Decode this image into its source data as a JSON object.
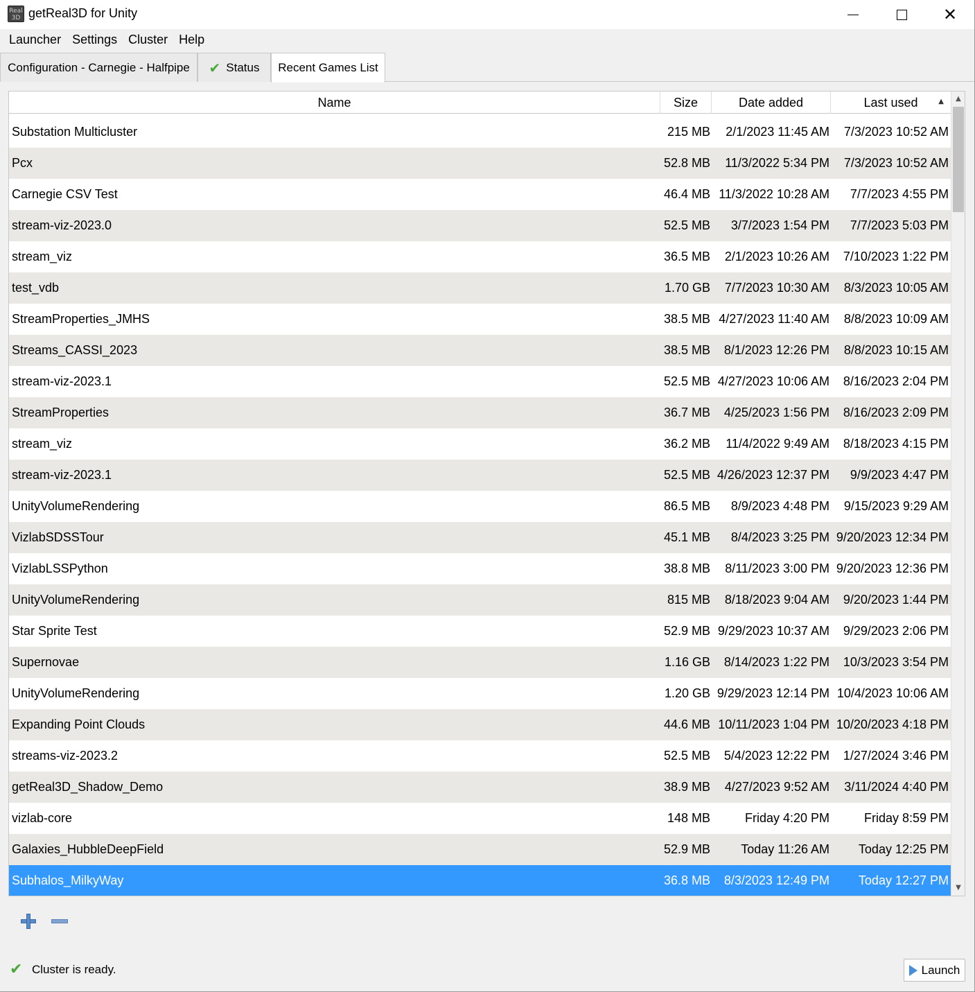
{
  "window": {
    "title": "getReal3D for Unity",
    "icon_label": "Real 3D"
  },
  "menu": [
    "Launcher",
    "Settings",
    "Cluster",
    "Help"
  ],
  "tabs": [
    {
      "label": "Configuration - Carnegie - Halfpipe",
      "active": false
    },
    {
      "label": "Status",
      "icon": "check-icon",
      "active": false
    },
    {
      "label": "Recent Games List",
      "active": true
    }
  ],
  "table": {
    "columns": {
      "name": "Name",
      "size": "Size",
      "date_added": "Date added",
      "last_used": "Last used"
    },
    "sort_column": "last_used",
    "sort_direction": "ascending",
    "rows": [
      {
        "name": "Substation Multicluster",
        "size": "215 MB",
        "date_added": "2/1/2023 11:45 AM",
        "last_used": "7/3/2023 10:52 AM"
      },
      {
        "name": "Pcx",
        "size": "52.8 MB",
        "date_added": "11/3/2022 5:34 PM",
        "last_used": "7/3/2023 10:52 AM"
      },
      {
        "name": "Carnegie CSV Test",
        "size": "46.4 MB",
        "date_added": "11/3/2022 10:28 AM",
        "last_used": "7/7/2023 4:55 PM"
      },
      {
        "name": "stream-viz-2023.0",
        "size": "52.5 MB",
        "date_added": "3/7/2023 1:54 PM",
        "last_used": "7/7/2023 5:03 PM"
      },
      {
        "name": "stream_viz",
        "size": "36.5 MB",
        "date_added": "2/1/2023 10:26 AM",
        "last_used": "7/10/2023 1:22 PM"
      },
      {
        "name": "test_vdb",
        "size": "1.70 GB",
        "date_added": "7/7/2023 10:30 AM",
        "last_used": "8/3/2023 10:05 AM"
      },
      {
        "name": "StreamProperties_JMHS",
        "size": "38.5 MB",
        "date_added": "4/27/2023 11:40 AM",
        "last_used": "8/8/2023 10:09 AM"
      },
      {
        "name": "Streams_CASSI_2023",
        "size": "38.5 MB",
        "date_added": "8/1/2023 12:26 PM",
        "last_used": "8/8/2023 10:15 AM"
      },
      {
        "name": "stream-viz-2023.1",
        "size": "52.5 MB",
        "date_added": "4/27/2023 10:06 AM",
        "last_used": "8/16/2023 2:04 PM"
      },
      {
        "name": "StreamProperties",
        "size": "36.7 MB",
        "date_added": "4/25/2023 1:56 PM",
        "last_used": "8/16/2023 2:09 PM"
      },
      {
        "name": "stream_viz",
        "size": "36.2 MB",
        "date_added": "11/4/2022 9:49 AM",
        "last_used": "8/18/2023 4:15 PM"
      },
      {
        "name": "stream-viz-2023.1",
        "size": "52.5 MB",
        "date_added": "4/26/2023 12:37 PM",
        "last_used": "9/9/2023 4:47 PM"
      },
      {
        "name": "UnityVolumeRendering",
        "size": "86.5 MB",
        "date_added": "8/9/2023 4:48 PM",
        "last_used": "9/15/2023 9:29 AM"
      },
      {
        "name": "VizlabSDSSTour",
        "size": "45.1 MB",
        "date_added": "8/4/2023 3:25 PM",
        "last_used": "9/20/2023 12:34 PM"
      },
      {
        "name": "VizlabLSSPython",
        "size": "38.8 MB",
        "date_added": "8/11/2023 3:00 PM",
        "last_used": "9/20/2023 12:36 PM"
      },
      {
        "name": "UnityVolumeRendering",
        "size": "815 MB",
        "date_added": "8/18/2023 9:04 AM",
        "last_used": "9/20/2023 1:44 PM"
      },
      {
        "name": "Star Sprite Test",
        "size": "52.9 MB",
        "date_added": "9/29/2023 10:37 AM",
        "last_used": "9/29/2023 2:06 PM"
      },
      {
        "name": "Supernovae",
        "size": "1.16 GB",
        "date_added": "8/14/2023 1:22 PM",
        "last_used": "10/3/2023 3:54 PM"
      },
      {
        "name": "UnityVolumeRendering",
        "size": "1.20 GB",
        "date_added": "9/29/2023 12:14 PM",
        "last_used": "10/4/2023 10:06 AM"
      },
      {
        "name": "Expanding Point Clouds",
        "size": "44.6 MB",
        "date_added": "10/11/2023 1:04 PM",
        "last_used": "10/20/2023 4:18 PM"
      },
      {
        "name": "streams-viz-2023.2",
        "size": "52.5 MB",
        "date_added": "5/4/2023 12:22 PM",
        "last_used": "1/27/2024 3:46 PM"
      },
      {
        "name": "getReal3D_Shadow_Demo",
        "size": "38.9 MB",
        "date_added": "4/27/2023 9:52 AM",
        "last_used": "3/11/2024 4:40 PM"
      },
      {
        "name": "vizlab-core",
        "size": "148 MB",
        "date_added": "Friday 4:20 PM",
        "last_used": "Friday 8:59 PM"
      },
      {
        "name": "Galaxies_HubbleDeepField",
        "size": "52.9 MB",
        "date_added": "Today 11:26 AM",
        "last_used": "Today 12:25 PM"
      },
      {
        "name": "Subhalos_MilkyWay",
        "size": "36.8 MB",
        "date_added": "8/3/2023 12:49 PM",
        "last_used": "Today 12:27 PM",
        "selected": true
      }
    ]
  },
  "status": {
    "text": "Cluster is ready.",
    "icon": "check-icon"
  },
  "launch_button": {
    "label": "Launch",
    "icon": "play-icon"
  },
  "colors": {
    "selection": "#3399ff",
    "alt_row": "#e9e8e5",
    "check": "#4aa83a"
  }
}
